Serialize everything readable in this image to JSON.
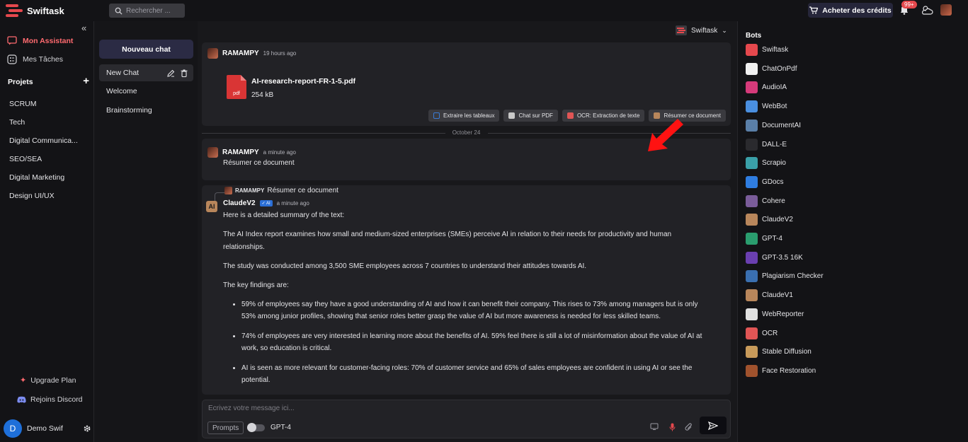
{
  "app": {
    "name": "Swiftask"
  },
  "topbar": {
    "search_placeholder": "Rechercher ...",
    "buy_credits": "Acheter des crédits",
    "notif_count": "99+"
  },
  "sidebar": {
    "nav": [
      {
        "label": "Mon Assistant"
      },
      {
        "label": "Mes Tâches"
      }
    ],
    "projects_label": "Projets",
    "projects": [
      "SCRUM",
      "Tech",
      "Digital Communica...",
      "SEO/SEA",
      "Digital Marketing",
      "Design UI/UX"
    ],
    "upgrade": "Upgrade Plan",
    "discord": "Rejoins Discord",
    "user": {
      "initial": "D",
      "name": "Demo Swif"
    }
  },
  "chatlist": {
    "new_chat": "Nouveau chat",
    "items": [
      "New Chat",
      "Welcome",
      "Brainstorming"
    ]
  },
  "main": {
    "bot_selected": "Swiftask",
    "msg1": {
      "author": "RAMAMPY",
      "time": "19 hours ago",
      "file_name": "AI-research-report-FR-1-5.pdf",
      "file_size": "254 kB",
      "file_type": "pdf"
    },
    "actions": [
      {
        "label": "Extraire les tableaux",
        "color": "#3a7bd5"
      },
      {
        "label": "Chat sur PDF",
        "color": "#c8c8c8"
      },
      {
        "label": "OCR: Extraction de texte",
        "color": "#e05555"
      },
      {
        "label": "Résumer ce document",
        "color": "#b8865b"
      }
    ],
    "date_sep": "October 24",
    "msg2": {
      "author": "RAMAMPY",
      "time": "a minute ago",
      "text": "Résumer ce document"
    },
    "msg3": {
      "reply_author": "RAMAMPY",
      "reply_text": "Résumer ce document",
      "author": "ClaudeV2",
      "badge": "✓ AI",
      "time": "a minute ago",
      "paragraphs": [
        "Here is a detailed summary of the text:",
        "The AI Index report examines how small and medium-sized enterprises (SMEs) perceive AI in relation to their needs for productivity and human relationships.",
        "The study was conducted among 3,500 SME employees across 7 countries to understand their attitudes towards AI.",
        "The key findings are:"
      ],
      "bullets": [
        "59% of employees say they have a good understanding of AI and how it can benefit their company. This rises to 73% among managers but is only 53% among junior profiles, showing that senior roles better grasp the value of AI but more awareness is needed for less skilled teams.",
        "74% of employees are very interested in learning more about the benefits of AI. 59% feel there is still a lot of misinformation about the value of AI at work, so education is critical.",
        "AI is seen as more relevant for customer-facing roles: 70% of customer service and 65% of sales employees are confident in using AI or see the potential."
      ]
    },
    "input": {
      "placeholder": "Ecrivez votre message ici...",
      "prompts": "Prompts",
      "model": "GPT-4"
    }
  },
  "bots": {
    "title": "Bots",
    "items": [
      {
        "name": "Swiftask",
        "color": "#e5484d"
      },
      {
        "name": "ChatOnPdf",
        "color": "#f0f0f0"
      },
      {
        "name": "AudioIA",
        "color": "#d63a7a"
      },
      {
        "name": "WebBot",
        "color": "#4a8fe0"
      },
      {
        "name": "DocumentAI",
        "color": "#5a7fa8"
      },
      {
        "name": "DALL-E",
        "color": "#2a2a2e"
      },
      {
        "name": "Scrapio",
        "color": "#3aa0a8"
      },
      {
        "name": "GDocs",
        "color": "#2f7de1"
      },
      {
        "name": "Cohere",
        "color": "#7a5c9a"
      },
      {
        "name": "ClaudeV2",
        "color": "#b8865b"
      },
      {
        "name": "GPT-4",
        "color": "#2a9d6e"
      },
      {
        "name": "GPT-3.5 16K",
        "color": "#6a3fb0"
      },
      {
        "name": "Plagiarism Checker",
        "color": "#3a6fb0"
      },
      {
        "name": "ClaudeV1",
        "color": "#b8865b"
      },
      {
        "name": "WebReporter",
        "color": "#e0e0e0"
      },
      {
        "name": "OCR",
        "color": "#e05555"
      },
      {
        "name": "Stable Diffusion",
        "color": "#c89a5a"
      },
      {
        "name": "Face Restoration",
        "color": "#a0522d"
      }
    ]
  }
}
